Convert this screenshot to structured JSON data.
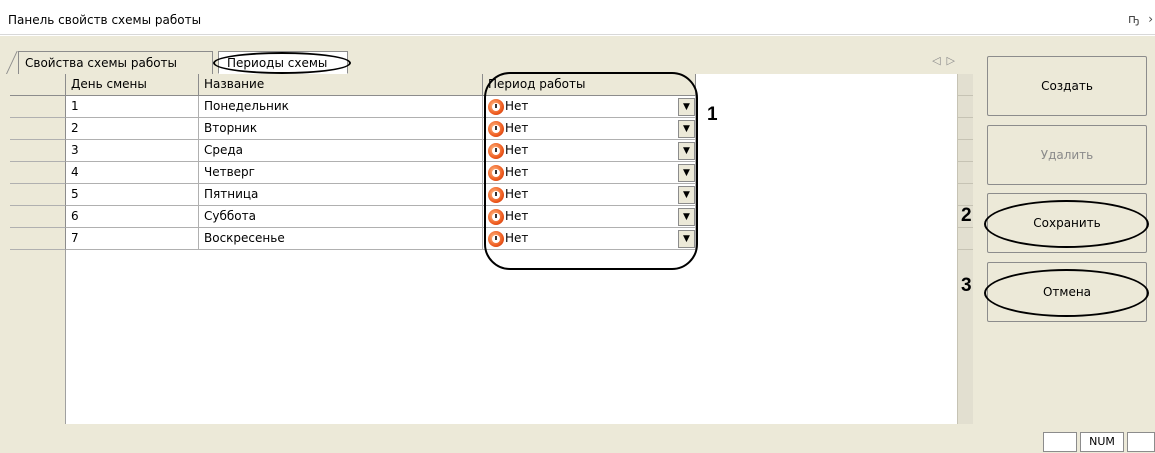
{
  "window": {
    "title": "Панель свойств схемы работы",
    "pin_icon": "pin-icon",
    "close_icon": "close-icon"
  },
  "tabs": [
    {
      "label": "Свойства схемы работы",
      "selected": false
    },
    {
      "label": "Периоды схемы",
      "selected": true
    }
  ],
  "table": {
    "headers": [
      "День смены",
      "Название",
      "Период работы"
    ],
    "rows": [
      {
        "day": "1",
        "name": "Понедельник",
        "period": "Нет"
      },
      {
        "day": "2",
        "name": "Вторник",
        "period": "Нет"
      },
      {
        "day": "3",
        "name": "Среда",
        "period": "Нет"
      },
      {
        "day": "4",
        "name": "Четверг",
        "period": "Нет"
      },
      {
        "day": "5",
        "name": "Пятница",
        "period": "Нет"
      },
      {
        "day": "6",
        "name": "Суббота",
        "period": "Нет"
      },
      {
        "day": "7",
        "name": "Воскресенье",
        "period": "Нет"
      }
    ]
  },
  "buttons": {
    "create": "Создать",
    "delete": "Удалить",
    "save": "Сохранить",
    "cancel": "Отмена"
  },
  "callouts": [
    "1",
    "2",
    "3"
  ],
  "statusbar": {
    "num": "NUM"
  },
  "colors": {
    "panel": "#ece9d8",
    "grid_bg": "#ffffff",
    "disabled_text": "#8a8a8a",
    "period_icon": "#ef5c1f"
  }
}
